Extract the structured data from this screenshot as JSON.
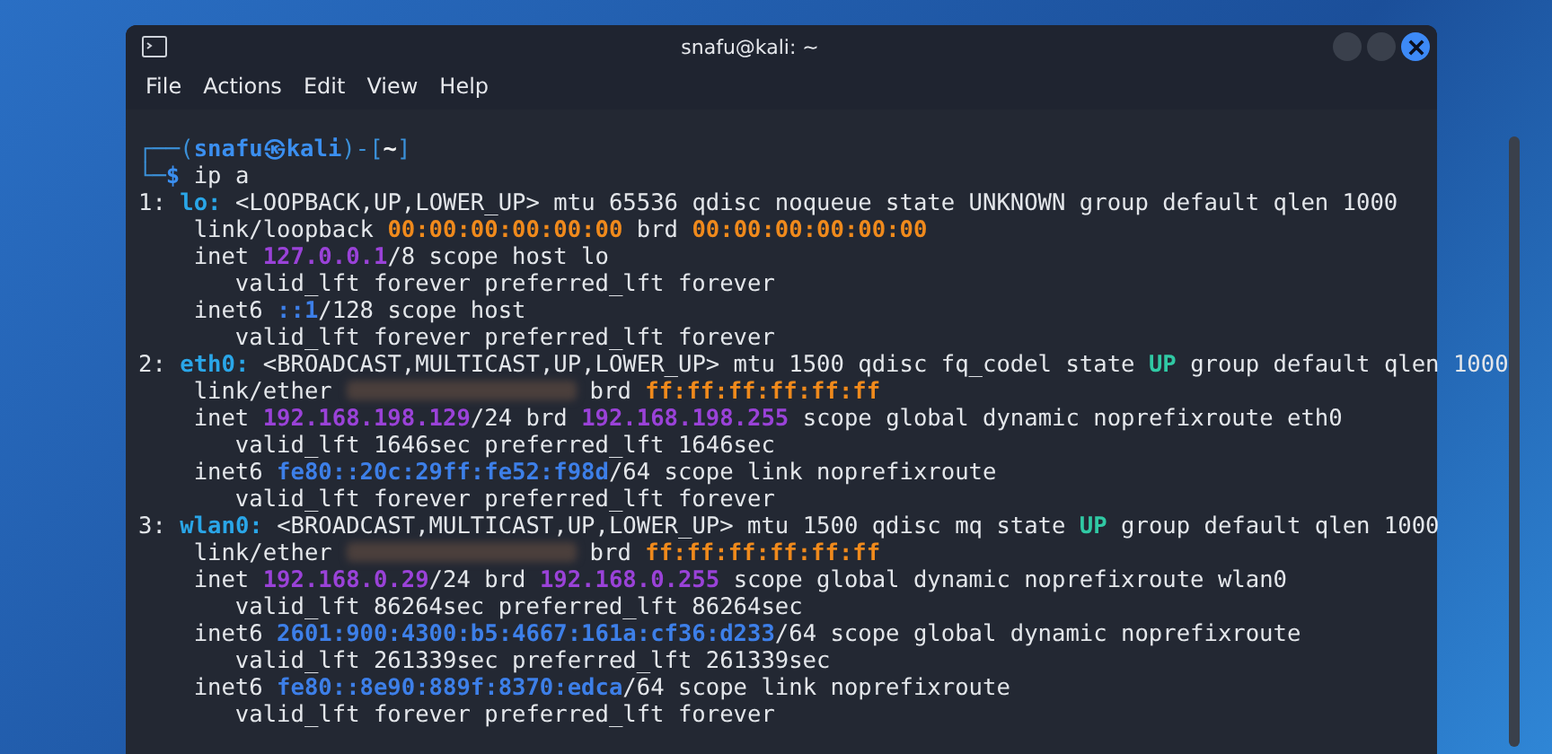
{
  "window": {
    "title": "snafu@kali: ~"
  },
  "menu": [
    {
      "label": "File"
    },
    {
      "label": "Actions"
    },
    {
      "label": "Edit"
    },
    {
      "label": "View"
    },
    {
      "label": "Help"
    }
  ],
  "terminal": {
    "lines": [
      {
        "segments": [
          {
            "text": "┌──(",
            "kind": "frame"
          },
          {
            "text": "snafu㉿kali",
            "kind": "user"
          },
          {
            "text": ")-[",
            "kind": "frame"
          },
          {
            "text": "~",
            "kind": "cwd"
          },
          {
            "text": "]",
            "kind": "frame"
          }
        ]
      },
      {
        "segments": [
          {
            "text": "└─",
            "kind": "frame"
          },
          {
            "text": "$",
            "kind": "user"
          },
          {
            "text": " ip a",
            "kind": "plain"
          }
        ]
      },
      {
        "segments": [
          {
            "text": "1: ",
            "kind": "plain"
          },
          {
            "text": "lo:",
            "kind": "iface"
          },
          {
            "text": " <LOOPBACK,UP,LOWER_UP> mtu 65536 qdisc noqueue state UNKNOWN group default qlen 1000",
            "kind": "plain"
          }
        ]
      },
      {
        "segments": [
          {
            "text": "    link/loopback ",
            "kind": "plain"
          },
          {
            "text": "00:00:00:00:00:00",
            "kind": "mac"
          },
          {
            "text": " brd ",
            "kind": "plain"
          },
          {
            "text": "00:00:00:00:00:00",
            "kind": "mac"
          }
        ]
      },
      {
        "segments": [
          {
            "text": "    inet ",
            "kind": "plain"
          },
          {
            "text": "127.0.0.1",
            "kind": "ip4"
          },
          {
            "text": "/8 scope host lo",
            "kind": "plain"
          }
        ]
      },
      {
        "segments": [
          {
            "text": "       valid_lft forever preferred_lft forever",
            "kind": "plain"
          }
        ]
      },
      {
        "segments": [
          {
            "text": "    inet6 ",
            "kind": "plain"
          },
          {
            "text": "::1",
            "kind": "ip6"
          },
          {
            "text": "/128 scope host",
            "kind": "plain"
          }
        ]
      },
      {
        "segments": [
          {
            "text": "       valid_lft forever preferred_lft forever",
            "kind": "plain"
          }
        ]
      },
      {
        "segments": [
          {
            "text": "2: ",
            "kind": "plain"
          },
          {
            "text": "eth0:",
            "kind": "iface"
          },
          {
            "text": " <BROADCAST,MULTICAST,UP,LOWER_UP> mtu 1500 qdisc fq_codel state ",
            "kind": "plain"
          },
          {
            "text": "UP",
            "kind": "up"
          },
          {
            "text": " group default qlen 1000",
            "kind": "plain"
          }
        ]
      },
      {
        "segments": [
          {
            "text": "    link/ether ",
            "kind": "plain"
          },
          {
            "kind": "blur"
          },
          {
            "text": " brd ",
            "kind": "plain"
          },
          {
            "text": "ff:ff:ff:ff:ff:ff",
            "kind": "mac"
          }
        ]
      },
      {
        "segments": [
          {
            "text": "    inet ",
            "kind": "plain"
          },
          {
            "text": "192.168.198.129",
            "kind": "ip4"
          },
          {
            "text": "/24 brd ",
            "kind": "plain"
          },
          {
            "text": "192.168.198.255",
            "kind": "ip4"
          },
          {
            "text": " scope global dynamic noprefixroute eth0",
            "kind": "plain"
          }
        ]
      },
      {
        "segments": [
          {
            "text": "       valid_lft 1646sec preferred_lft 1646sec",
            "kind": "plain"
          }
        ]
      },
      {
        "segments": [
          {
            "text": "    inet6 ",
            "kind": "plain"
          },
          {
            "text": "fe80::20c:29ff:fe52:f98d",
            "kind": "ip6"
          },
          {
            "text": "/64 scope link noprefixroute",
            "kind": "plain"
          }
        ]
      },
      {
        "segments": [
          {
            "text": "       valid_lft forever preferred_lft forever",
            "kind": "plain"
          }
        ]
      },
      {
        "segments": [
          {
            "text": "3: ",
            "kind": "plain"
          },
          {
            "text": "wlan0:",
            "kind": "iface"
          },
          {
            "text": " <BROADCAST,MULTICAST,UP,LOWER_UP> mtu 1500 qdisc mq state ",
            "kind": "plain"
          },
          {
            "text": "UP",
            "kind": "up"
          },
          {
            "text": " group default qlen 1000",
            "kind": "plain"
          }
        ]
      },
      {
        "segments": [
          {
            "text": "    link/ether ",
            "kind": "plain"
          },
          {
            "kind": "blur"
          },
          {
            "text": " brd ",
            "kind": "plain"
          },
          {
            "text": "ff:ff:ff:ff:ff:ff",
            "kind": "mac"
          }
        ]
      },
      {
        "segments": [
          {
            "text": "    inet ",
            "kind": "plain"
          },
          {
            "text": "192.168.0.29",
            "kind": "ip4"
          },
          {
            "text": "/24 brd ",
            "kind": "plain"
          },
          {
            "text": "192.168.0.255",
            "kind": "ip4"
          },
          {
            "text": " scope global dynamic noprefixroute wlan0",
            "kind": "plain"
          }
        ]
      },
      {
        "segments": [
          {
            "text": "       valid_lft 86264sec preferred_lft 86264sec",
            "kind": "plain"
          }
        ]
      },
      {
        "segments": [
          {
            "text": "    inet6 ",
            "kind": "plain"
          },
          {
            "text": "2601:900:4300:b5:4667:161a:cf36:d233",
            "kind": "ip6"
          },
          {
            "text": "/64 scope global dynamic noprefixroute",
            "kind": "plain"
          }
        ]
      },
      {
        "segments": [
          {
            "text": "       valid_lft 261339sec preferred_lft 261339sec",
            "kind": "plain"
          }
        ]
      },
      {
        "segments": [
          {
            "text": "    inet6 ",
            "kind": "plain"
          },
          {
            "text": "fe80::8e90:889f:8370:edca",
            "kind": "ip6"
          },
          {
            "text": "/64 scope link noprefixroute",
            "kind": "plain"
          }
        ]
      },
      {
        "segments": [
          {
            "text": "       valid_lft forever preferred_lft forever",
            "kind": "plain"
          }
        ]
      }
    ]
  }
}
